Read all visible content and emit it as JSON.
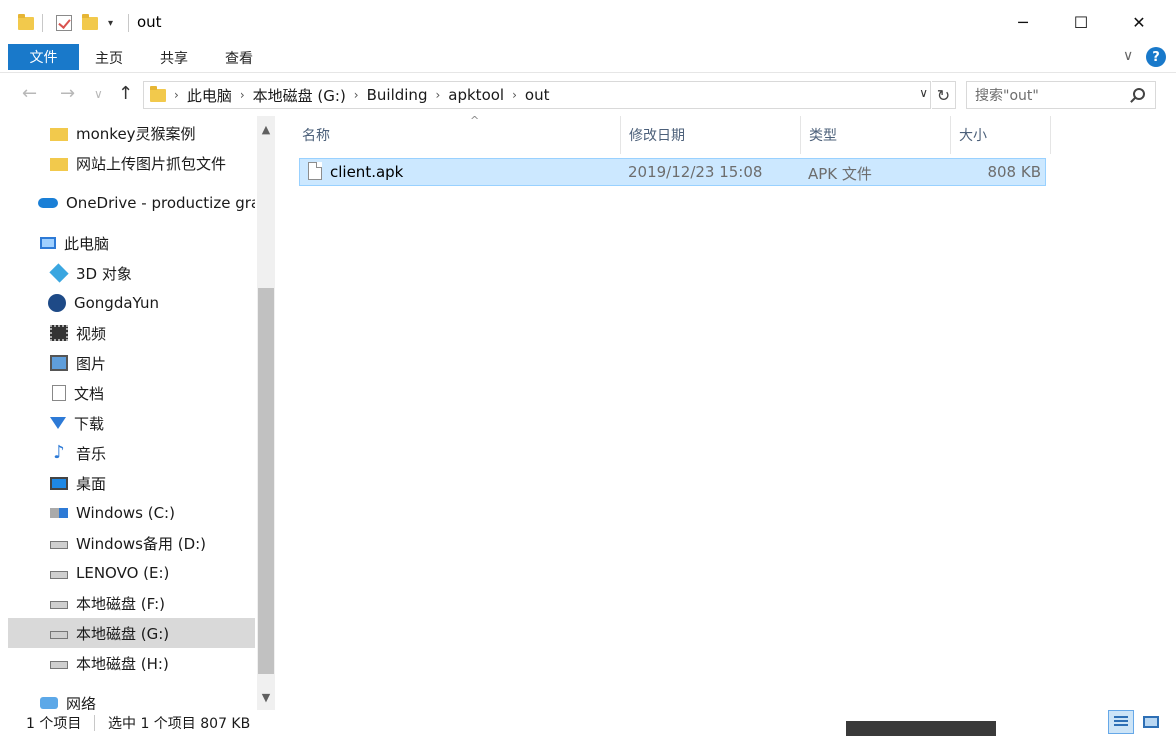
{
  "window": {
    "title": "out",
    "controls": {
      "minimize": "─",
      "maximize": "☐",
      "close": "✕"
    }
  },
  "ribbon": {
    "tabs": [
      "文件",
      "主页",
      "共享",
      "查看"
    ],
    "collapse_caret": "∨",
    "help": "?"
  },
  "address": {
    "back": "←",
    "forward": "→",
    "recent": "∨",
    "up": "↑",
    "breadcrumbs": [
      "此电脑",
      "本地磁盘 (G:)",
      "Building",
      "apktool",
      "out"
    ],
    "crumb_sep": "›",
    "dropdown": "∨",
    "refresh": "↻",
    "search_placeholder": "搜索\"out\""
  },
  "nav": {
    "items": [
      {
        "label": "monkey灵猴案例",
        "icon": "folder-icon"
      },
      {
        "label": "网站上传图片抓包文件",
        "icon": "folder-icon"
      },
      {
        "label": "OneDrive - productize grar",
        "icon": "onedrive-cloud-icon"
      },
      {
        "label": "此电脑",
        "icon": "this-pc-icon"
      },
      {
        "label": "3D 对象",
        "icon": "3d-objects-icon"
      },
      {
        "label": "GongdaYun",
        "icon": "gongdayun-icon"
      },
      {
        "label": "视频",
        "icon": "videos-icon"
      },
      {
        "label": "图片",
        "icon": "pictures-icon"
      },
      {
        "label": "文档",
        "icon": "documents-icon"
      },
      {
        "label": "下载",
        "icon": "downloads-icon"
      },
      {
        "label": "音乐",
        "icon": "music-icon"
      },
      {
        "label": "桌面",
        "icon": "desktop-icon"
      },
      {
        "label": "Windows (C:)",
        "icon": "windows-drive-icon"
      },
      {
        "label": "Windows备用 (D:)",
        "icon": "drive-icon"
      },
      {
        "label": "LENOVO (E:)",
        "icon": "drive-icon"
      },
      {
        "label": "本地磁盘 (F:)",
        "icon": "drive-icon"
      },
      {
        "label": "本地磁盘 (G:)",
        "icon": "drive-icon",
        "selected": true
      },
      {
        "label": "本地磁盘 (H:)",
        "icon": "drive-icon"
      },
      {
        "label": "网络",
        "icon": "network-icon"
      }
    ],
    "scroll_up": "▲",
    "scroll_down": "▼"
  },
  "files": {
    "columns": [
      "名称",
      "修改日期",
      "类型",
      "大小"
    ],
    "sort_indicator": "^",
    "rows": [
      {
        "name": "client.apk",
        "modified": "2019/12/23 15:08",
        "type": "APK 文件",
        "size": "808 KB",
        "selected": true
      }
    ]
  },
  "status": {
    "item_count": "1 个项目",
    "selection": "选中 1 个项目  807 KB"
  },
  "colors": {
    "accent": "#1979ca",
    "selection_bg": "#cce8ff",
    "selection_border": "#99d1ff",
    "nav_selected": "#d9d9d9"
  }
}
